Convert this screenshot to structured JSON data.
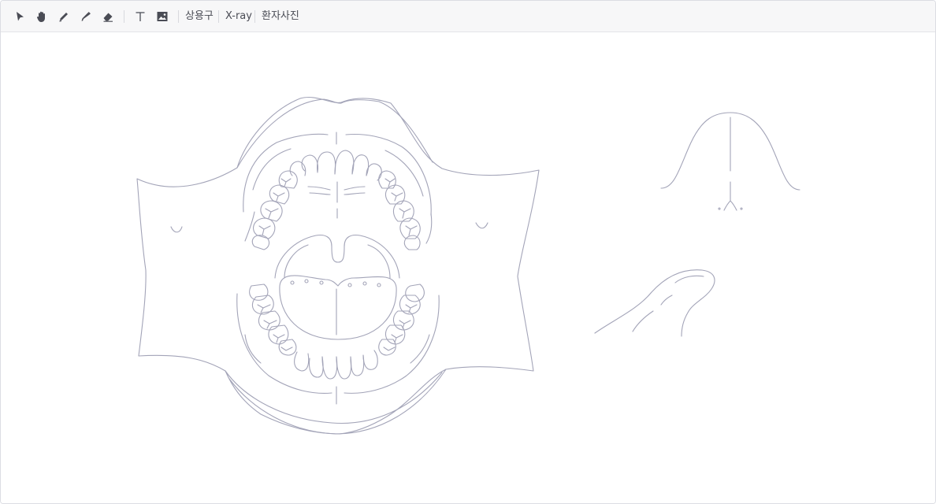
{
  "toolbar": {
    "tools": [
      {
        "name": "select-arrow-icon"
      },
      {
        "name": "hand-pan-icon"
      },
      {
        "name": "pen-icon"
      },
      {
        "name": "marker-icon"
      },
      {
        "name": "eraser-icon"
      },
      {
        "name": "text-icon"
      },
      {
        "name": "image-icon"
      }
    ],
    "text_buttons": {
      "phrases": "상용구",
      "xray": "X-ray",
      "patient_photo": "환자사진"
    }
  },
  "canvas": {
    "diagrams": [
      "open-mouth-teeth-chart",
      "nose-outline",
      "tongue-outline"
    ]
  },
  "colors": {
    "line": "#a3a4b8",
    "toolbar_bg": "#f7f7f8",
    "icon": "#4a4c55"
  }
}
